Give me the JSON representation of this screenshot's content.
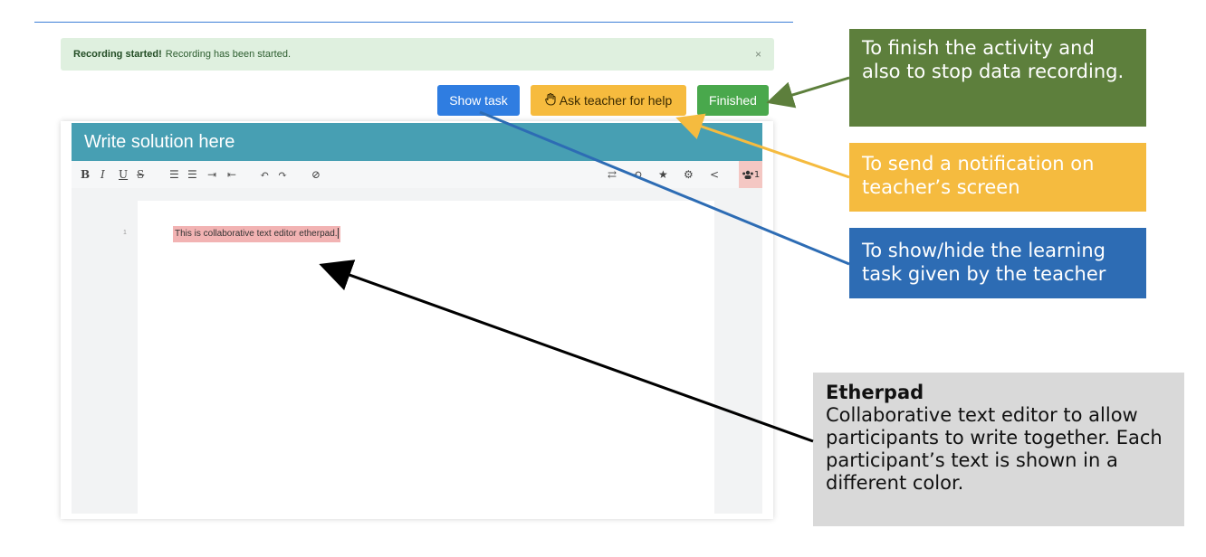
{
  "alert": {
    "strong": "Recording started!",
    "text": "Recording has been started.",
    "close": "×"
  },
  "buttons": {
    "show_task": "Show task",
    "ask_help": "Ask teacher for help",
    "finished": "Finished"
  },
  "panel": {
    "title": "Write solution here"
  },
  "toolbar": {
    "bold": "B",
    "italic": "I",
    "underline": "U",
    "strike": "S",
    "ordered_list": "☰",
    "unordered_list": "☰",
    "indent": "⇥",
    "outdent": "⇤",
    "undo": "↶",
    "redo": "↷",
    "hide": "⊘",
    "import_export": "⇄",
    "history": "⟲",
    "star": "★",
    "settings": "⚙",
    "share": "<",
    "users": "1"
  },
  "editor": {
    "line_number": "1",
    "text": "This is collaborative text editor etherpad."
  },
  "annotations": {
    "finished": "To finish the activity and also to stop data recording.",
    "help": "To send a notification on teacher’s screen",
    "task": "To show/hide the learning task given by the teacher",
    "etherpad_title": "Etherpad",
    "etherpad_text": "Collaborative text editor to allow participants to write together. Each participant’s text is shown in a different color."
  },
  "colors": {
    "header": "#479fb3",
    "show_task": "#2f7de1",
    "ask_help": "#f6bb3e",
    "finished": "#49a84c",
    "note_green": "#5d7f3c",
    "note_yellow": "#f5bb3f",
    "note_blue": "#2d6cb4",
    "note_grey": "#d9d9d9"
  }
}
